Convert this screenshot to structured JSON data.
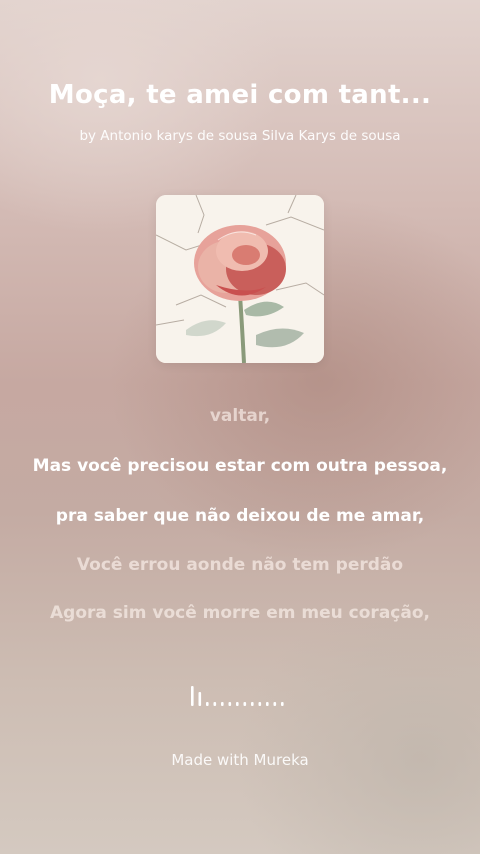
{
  "song": {
    "title": "Moça, te amei com tant...",
    "artist": "by Antonio karys de sousa Silva Karys de sousa"
  },
  "cover": {
    "icon": "rose-artwork-icon"
  },
  "lyrics": {
    "lines": [
      "valtar,",
      "Mas você  precisou estar com outra pessoa,",
      "pra saber que não deixou de me amar,",
      "Você errou aonde não tem perdão",
      "Agora sim você morre em meu coração,"
    ],
    "active_lines": [
      1,
      2
    ]
  },
  "playback": {
    "progress": 0.08,
    "icon": "audio-progress-bars-icon"
  },
  "footer": {
    "label": "Made with Mureka"
  },
  "colors": {
    "text": "#ffffff",
    "background": "#c9aea7"
  }
}
